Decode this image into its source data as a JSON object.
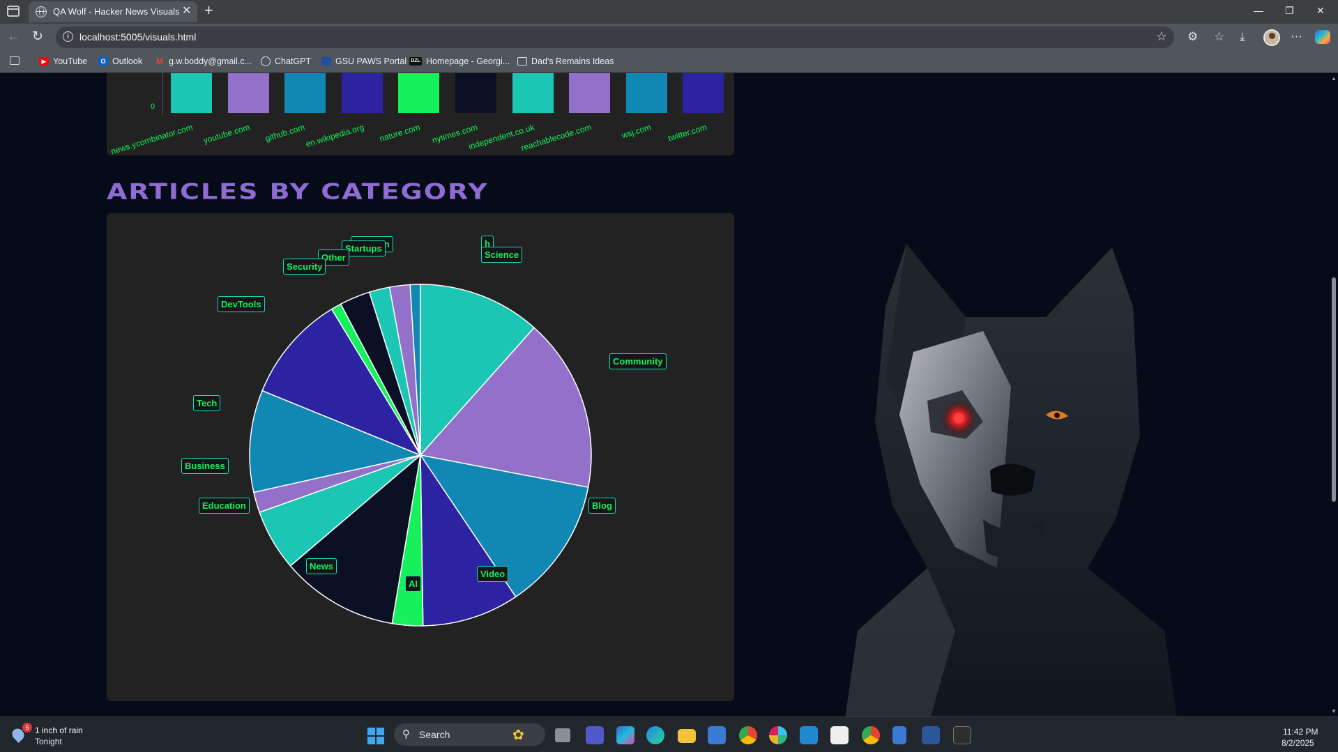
{
  "browser": {
    "tab_title": "QA Wolf - Hacker News Visuals",
    "tab_close": "✕",
    "new_tab": "+",
    "url": "localhost:5005/visuals.html",
    "bookmarks": [
      {
        "label": "YouTube",
        "icon": "youtube-icon",
        "color": "#ff0000"
      },
      {
        "label": "Outlook",
        "icon": "outlook-icon",
        "color": "#0a64c8"
      },
      {
        "label": "g.w.boddy@gmail.c...",
        "icon": "gmail-icon",
        "color": "#ea4335"
      },
      {
        "label": "ChatGPT",
        "icon": "chatgpt-icon",
        "color": "#d0d0d0"
      },
      {
        "label": "GSU PAWS Portal",
        "icon": "gsu-icon",
        "color": "#1c4fa0"
      },
      {
        "label": "Homepage - Georgi...",
        "icon": "dzl-icon",
        "color": "#111111"
      },
      {
        "label": "Dad's Remains Ideas",
        "icon": "folder-icon",
        "color": "#d0d0d0"
      }
    ]
  },
  "domains_chart": {
    "zero_label": "0",
    "colors": [
      "#1cc6b4",
      "#9370c9",
      "#1188b4",
      "#2c23a3",
      "#16f05a",
      "#0b1024",
      "#1cc6b4",
      "#9370c9",
      "#1188b4",
      "#2c23a3"
    ],
    "labels": [
      "news.ycombinator.com",
      "youtube.com",
      "github.com",
      "en.wikipedia.org",
      "nature.com",
      "nytimes.com",
      "independent.co.uk",
      "reachablecode.com",
      "wsj.com",
      "twitter.com"
    ]
  },
  "section_title": "Articles by Category",
  "chart_data": {
    "type": "pie",
    "title": "Articles by Category",
    "categories": [
      "Science",
      "Community",
      "Blog",
      "Video",
      "AI",
      "News",
      "Education",
      "Business",
      "Tech",
      "DevTools",
      "Security",
      "Other",
      "Startups",
      "Documentation",
      "Research"
    ],
    "values": [
      12,
      17,
      13,
      9.5,
      3,
      11.5,
      6,
      2,
      10,
      10.5,
      1,
      3,
      2,
      2,
      1
    ],
    "colors": [
      "#1cc6b4",
      "#9370c9",
      "#1188b4",
      "#2c23a3",
      "#16f05a",
      "#0b1024",
      "#1cc6b4",
      "#9370c9",
      "#1188b4",
      "#2c23a3",
      "#16f05a",
      "#0b1024",
      "#1cc6b4",
      "#9370c9",
      "#1188b4"
    ],
    "legend": "labels-around-pie"
  },
  "pie_labels_visible": [
    "Science",
    "Community",
    "Blog",
    "Video",
    "AI",
    "News",
    "Education",
    "Business",
    "Tech",
    "DevTools",
    "Security",
    "Other",
    "Startups",
    "entation",
    "h"
  ],
  "taskbar": {
    "weather_badge": "5",
    "weather_line1": "1 inch of rain",
    "weather_line2": "Tonight",
    "search_placeholder": "Search",
    "time": "11:42 PM",
    "date": "8/2/2025"
  }
}
